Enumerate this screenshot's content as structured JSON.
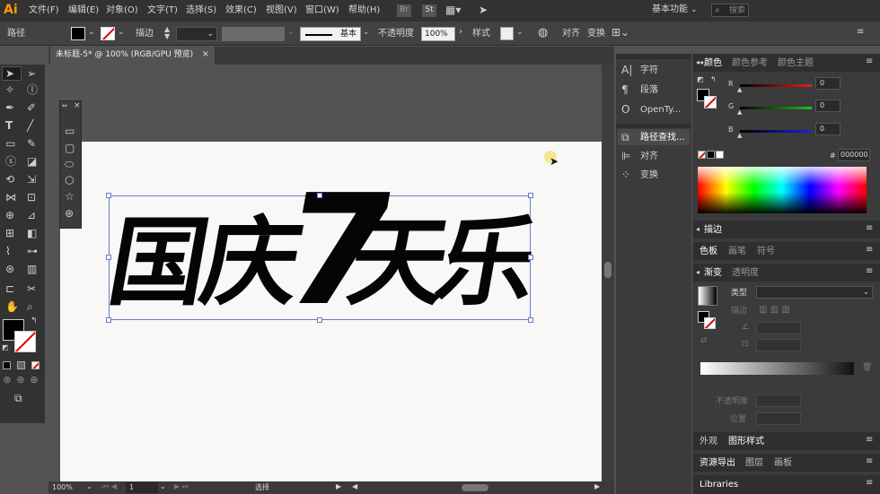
{
  "app": {
    "logo": "Ai",
    "workspace": "基本功能",
    "search_placeholder": "搜索"
  },
  "menu": [
    "文件(F)",
    "编辑(E)",
    "对象(O)",
    "文字(T)",
    "选择(S)",
    "效果(C)",
    "视图(V)",
    "窗口(W)",
    "帮助(H)"
  ],
  "menu_icons": [
    "Br",
    "St"
  ],
  "control": {
    "selection_type": "路径",
    "stroke_label": "描边",
    "stroke_style": "基本",
    "opacity_label": "不透明度",
    "opacity_value": "100%",
    "style_label": "样式",
    "align_label": "对齐",
    "transform_label": "变换"
  },
  "document": {
    "tab_title": "未标题-5* @ 100% (RGB/GPU 预览)",
    "close": "×"
  },
  "artwork": {
    "chars": [
      "国",
      "庆",
      "7",
      "天",
      "乐"
    ],
    "selection_color": "#6b79c9"
  },
  "mid_panel": {
    "items": [
      "字符",
      "段落",
      "OpenTy...",
      "路径查找...",
      "对齐",
      "变换"
    ]
  },
  "color_panel": {
    "tabs": [
      "颜色",
      "颜色参考",
      "颜色主题"
    ],
    "r_label": "R",
    "g_label": "G",
    "b_label": "B",
    "r": "0",
    "g": "0",
    "b": "0",
    "hex_prefix": "#",
    "hex": "000000"
  },
  "stroke_panel": {
    "title": "描边"
  },
  "swatch_tabs": [
    "色板",
    "画笔",
    "符号"
  ],
  "gradient_panel": {
    "tabs": [
      "渐变",
      "透明度"
    ],
    "type_label": "类型",
    "stroke_label": "描边",
    "opacity_label": "不透明度",
    "position_label": "位置"
  },
  "appearance_tabs": [
    "外观",
    "图形样式"
  ],
  "export_tabs": [
    "资源导出",
    "图层",
    "画板"
  ],
  "libraries": "Libraries",
  "status": {
    "zoom": "100%",
    "artboard_num": "1",
    "tool": "选择"
  },
  "colors": {
    "accent": "#6b79c9",
    "red_slider": "#e02020",
    "green_slider": "#20c020",
    "blue_slider": "#2020e0"
  }
}
